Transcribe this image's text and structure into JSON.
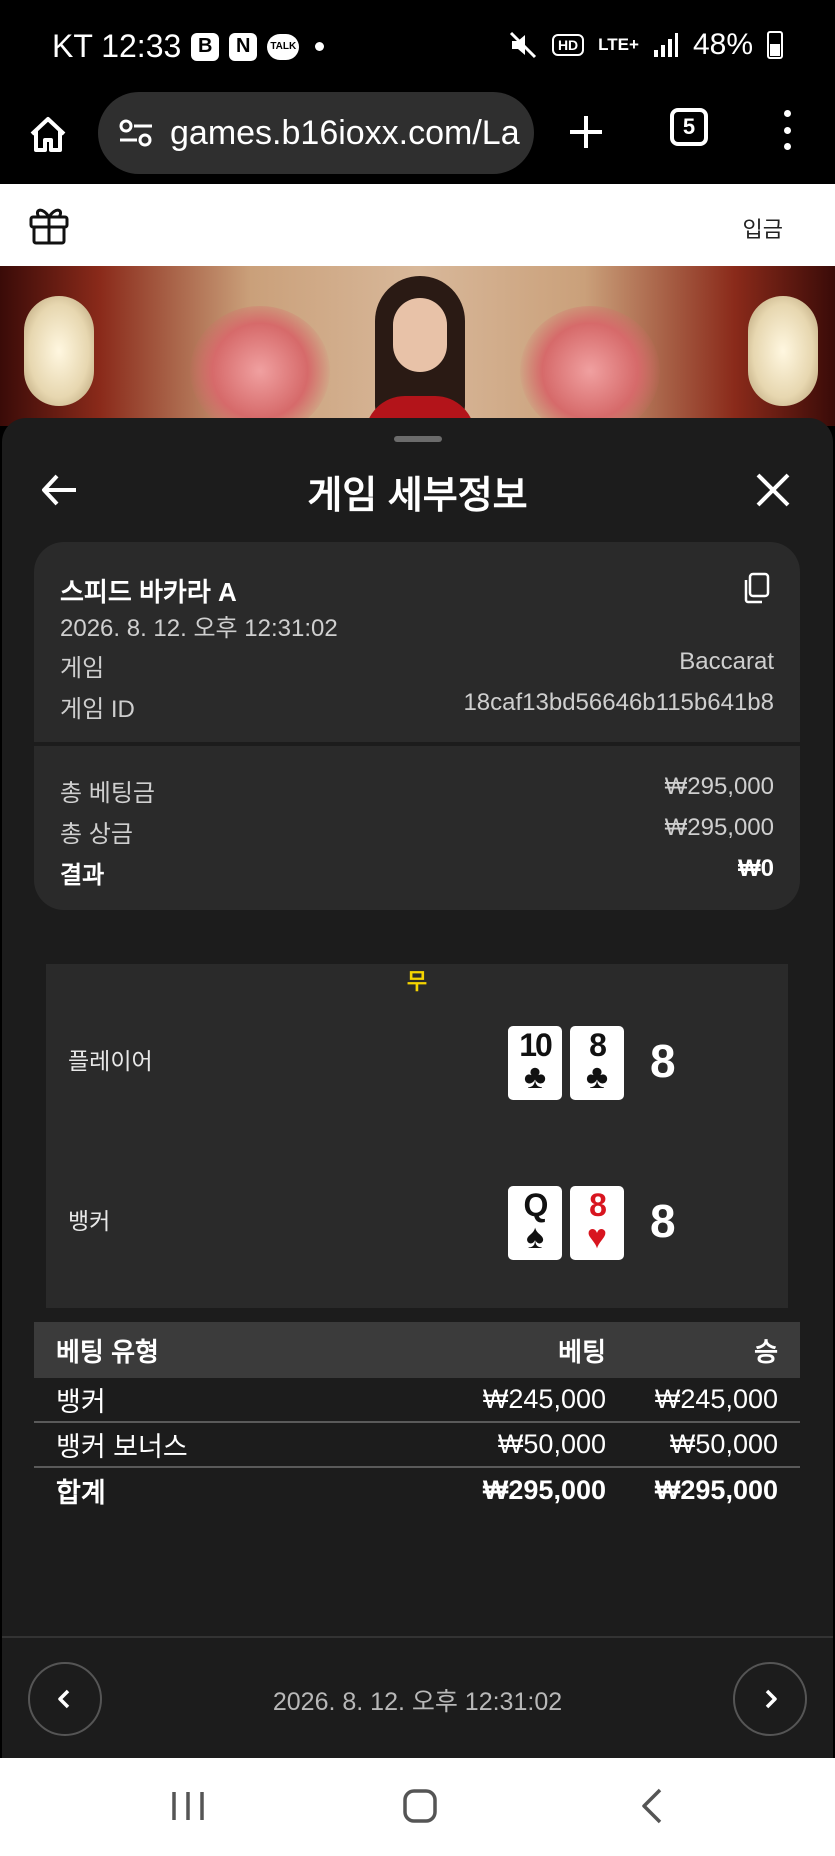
{
  "status_bar": {
    "carrier_time": "KT 12:33",
    "badge_b": "B",
    "badge_n": "N",
    "badge_talk": "TALK",
    "hd": "HD",
    "network": "LTE+",
    "battery": "48%"
  },
  "browser": {
    "url": "games.b16ioxx.com/La",
    "tab_count": "5"
  },
  "site_header": {
    "deposit_label": "입금"
  },
  "sheet": {
    "title": "게임 세부정보",
    "game_name": "스피드 바카라 A",
    "datetime": "2026. 8. 12. 오후 12:31:02",
    "game_label": "게임",
    "game_value": "Baccarat",
    "game_id_label": "게임 ID",
    "game_id_value": "18caf13bd56646b115b641b8",
    "total_bet_label": "총 베팅금",
    "total_bet_value": "₩295,000",
    "total_prize_label": "총 상금",
    "total_prize_value": "₩295,000",
    "result_label": "결과",
    "result_value": "₩0"
  },
  "board": {
    "outcome": "무",
    "player": {
      "label": "플레이어",
      "cards": [
        {
          "rank": "10",
          "suit": "♣"
        },
        {
          "rank": "8",
          "suit": "♣"
        }
      ],
      "score": "8"
    },
    "banker": {
      "label": "뱅커",
      "cards": [
        {
          "rank": "Q",
          "suit": "♠"
        },
        {
          "rank": "8",
          "suit": "♥"
        }
      ],
      "score": "8"
    }
  },
  "bets": {
    "headers": [
      "베팅 유형",
      "베팅",
      "승"
    ],
    "rows": [
      [
        "뱅커",
        "₩245,000",
        "₩245,000"
      ],
      [
        "뱅커 보너스",
        "₩50,000",
        "₩50,000"
      ],
      [
        "합계",
        "₩295,000",
        "₩295,000"
      ]
    ]
  },
  "footer": {
    "datetime": "2026. 8. 12. 오후 12:31:02"
  },
  "colors": {
    "tie_yellow": "#f5d400",
    "card_red": "#d8151f",
    "sheet_bg": "#1c1c1c",
    "card_bg": "#2a2a2a"
  }
}
